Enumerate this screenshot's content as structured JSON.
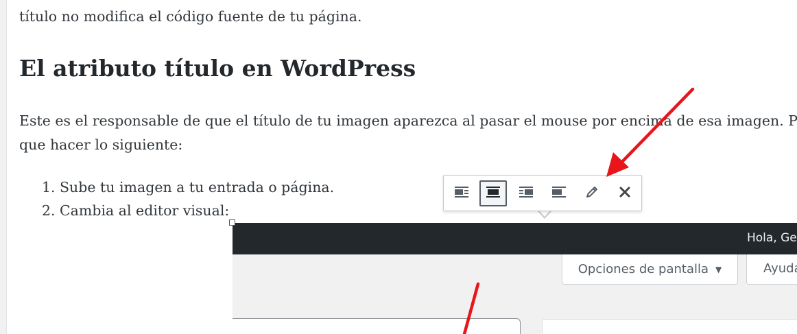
{
  "article": {
    "top_line": "título no modifica el código fuente de tu página.",
    "heading": "El atributo título en WordPress",
    "paragraph_line1": "Este es el responsable de que el título de tu imagen aparezca al pasar el mouse por encima de esa imagen. Pa",
    "paragraph_line2": "que hacer lo siguiente:",
    "steps": [
      {
        "number": "1.",
        "text": "Sube tu imagen a tu entrada o página."
      },
      {
        "number": "2.",
        "text": "Cambia al editor visual:"
      }
    ]
  },
  "image_toolbar": {
    "buttons": [
      {
        "icon": "align-left-icon",
        "active": false
      },
      {
        "icon": "align-center-icon",
        "active": true
      },
      {
        "icon": "align-right-icon",
        "active": false
      },
      {
        "icon": "align-none-icon",
        "active": false
      },
      {
        "icon": "pencil-edit-icon",
        "active": false
      },
      {
        "icon": "close-remove-icon",
        "active": false
      }
    ]
  },
  "embedded_screenshot": {
    "greeting": "Hola, Ge",
    "screen_options_label": "Opciones de pantalla",
    "screen_options_caret": "▼",
    "help_label": "Ayuda"
  },
  "colors": {
    "annotation_arrow": "#e8161b",
    "admin_bar": "#23282d",
    "text": "#32373c"
  }
}
